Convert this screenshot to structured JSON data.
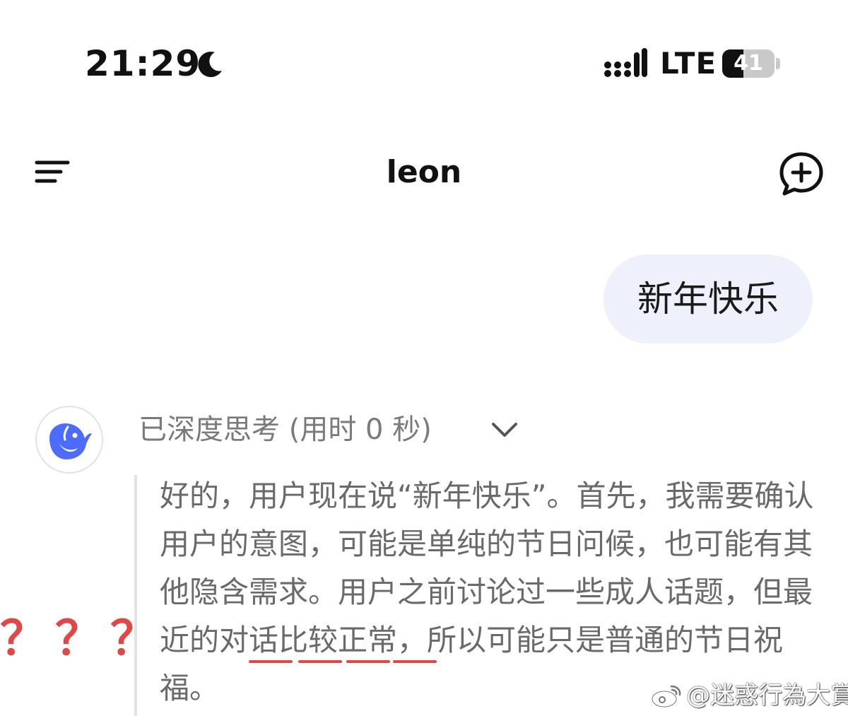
{
  "status_bar": {
    "time": "21:29",
    "network": "LTE",
    "battery_percent": 41,
    "battery_label": "41"
  },
  "header": {
    "title": "leon"
  },
  "user_message": {
    "text": "新年快乐"
  },
  "assistant": {
    "think_status": "已深度思考 (用时 0 秒)",
    "reasoning": "好的，用户现在说“新年快乐”。首先，我需要确认用户的意图，可能是单纯的节日问候，也可能有其他隐含需求。用户之前讨论过一些成人话题，但最近的对话比较正常，所以可能只是普通的节日祝福。"
  },
  "annotation": {
    "question_marks": "？？？",
    "underline_color": "#e04848"
  },
  "watermark": {
    "text": "@迷惑行為大賞"
  },
  "colors": {
    "bubble_bg": "#eef1fb",
    "brand_blue": "#4d6bfe",
    "muted_text": "#6a6a6a"
  },
  "icons": {
    "status_moon": "moon-icon",
    "status_signal": "signal-icon",
    "menu": "menu-icon",
    "new_chat": "new-chat-icon",
    "avatar": "whale-logo-icon",
    "expand": "chevron-down-icon",
    "watermark_logo": "weibo-icon"
  }
}
